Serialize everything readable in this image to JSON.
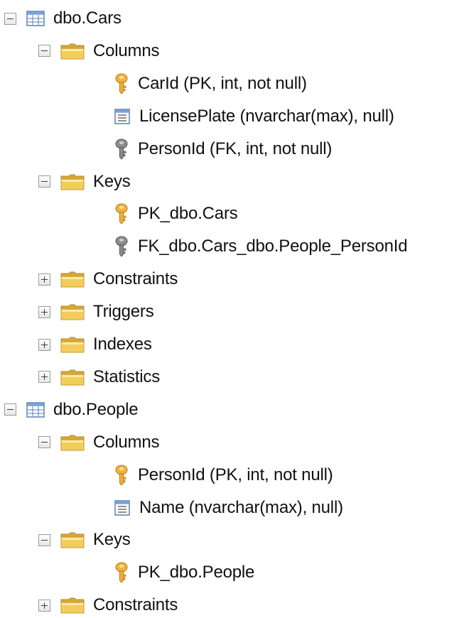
{
  "tree": [
    {
      "label": "dbo.Cars",
      "level": 0,
      "toggle": "minus",
      "icon": "table-icon"
    },
    {
      "label": "Columns",
      "level": 1,
      "toggle": "minus",
      "icon": "folder-icon"
    },
    {
      "label": "CarId (PK, int, not null)",
      "level": 2,
      "toggle": "none",
      "icon": "primary-key-icon"
    },
    {
      "label": "LicensePlate (nvarchar(max), null)",
      "level": 2,
      "toggle": "none",
      "icon": "column-icon"
    },
    {
      "label": "PersonId (FK, int, not null)",
      "level": 2,
      "toggle": "none",
      "icon": "foreign-key-icon"
    },
    {
      "label": "Keys",
      "level": 1,
      "toggle": "minus",
      "icon": "folder-icon"
    },
    {
      "label": "PK_dbo.Cars",
      "level": 2,
      "toggle": "none",
      "icon": "primary-key-icon"
    },
    {
      "label": "FK_dbo.Cars_dbo.People_PersonId",
      "level": 2,
      "toggle": "none",
      "icon": "foreign-key-icon"
    },
    {
      "label": "Constraints",
      "level": 1,
      "toggle": "plus",
      "icon": "folder-icon"
    },
    {
      "label": "Triggers",
      "level": 1,
      "toggle": "plus",
      "icon": "folder-icon"
    },
    {
      "label": "Indexes",
      "level": 1,
      "toggle": "plus",
      "icon": "folder-icon"
    },
    {
      "label": "Statistics",
      "level": 1,
      "toggle": "plus",
      "icon": "folder-icon"
    },
    {
      "label": "dbo.People",
      "level": 0,
      "toggle": "minus",
      "icon": "table-icon"
    },
    {
      "label": "Columns",
      "level": 1,
      "toggle": "minus",
      "icon": "folder-icon"
    },
    {
      "label": "PersonId (PK, int, not null)",
      "level": 2,
      "toggle": "none",
      "icon": "primary-key-icon"
    },
    {
      "label": "Name (nvarchar(max), null)",
      "level": 2,
      "toggle": "none",
      "icon": "column-icon"
    },
    {
      "label": "Keys",
      "level": 1,
      "toggle": "minus",
      "icon": "folder-icon"
    },
    {
      "label": "PK_dbo.People",
      "level": 2,
      "toggle": "none",
      "icon": "primary-key-icon"
    },
    {
      "label": "Constraints",
      "level": 1,
      "toggle": "plus",
      "icon": "folder-icon"
    }
  ],
  "colors": {
    "folder": "#e8bf45",
    "primary_key": "#e5a52b",
    "foreign_key": "#7b7b7b",
    "table_blue": "#5b7fb8"
  }
}
